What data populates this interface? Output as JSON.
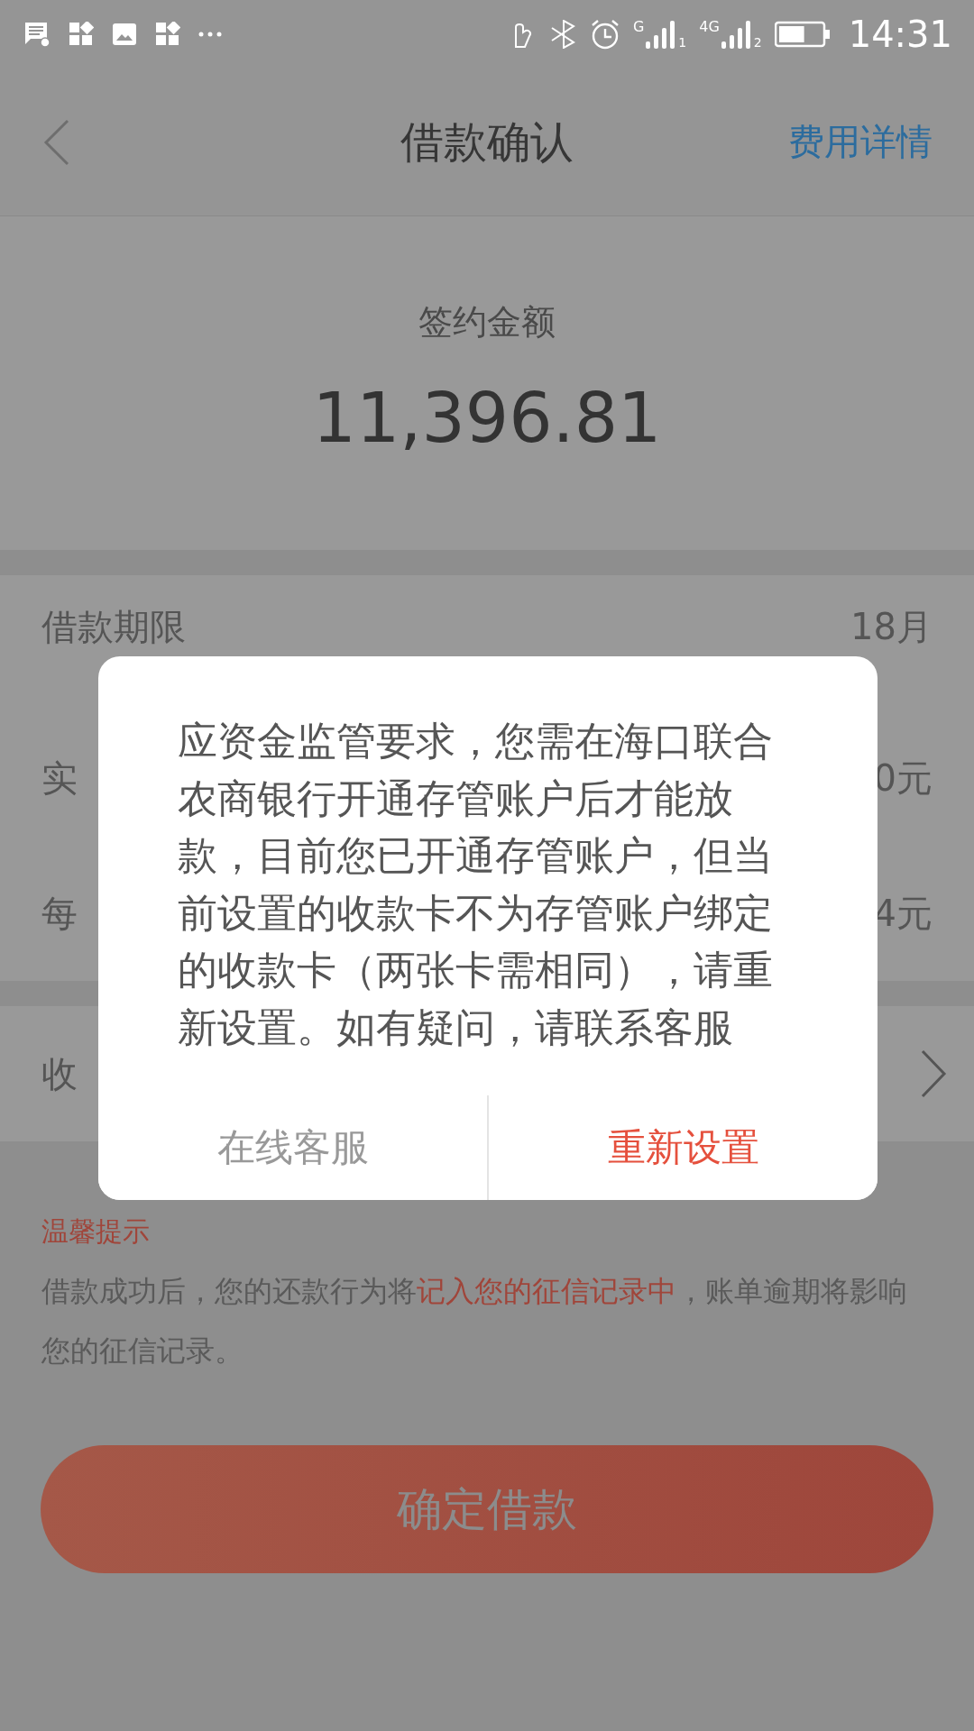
{
  "status_bar": {
    "signals": [
      {
        "network": "G",
        "sim": "1"
      },
      {
        "network": "4G",
        "sim": "2"
      }
    ],
    "battery": {
      "level": 0.6
    },
    "time": "14:31"
  },
  "header": {
    "title": "借款确认",
    "action": "费用详情"
  },
  "amount": {
    "label": "签约金额",
    "value": "11,396.81"
  },
  "rows": [
    {
      "label": "借款期限",
      "value": "18月"
    },
    {
      "label": "实",
      "value": "0元"
    },
    {
      "label": "每",
      "value": "4元"
    }
  ],
  "card_row": {
    "label": "收",
    "chevron": true
  },
  "tip": {
    "title": "温馨提示",
    "segments": [
      {
        "text": "借款成功后，您的还款行为将",
        "emphasis": false
      },
      {
        "text": "记入您的征信记录中",
        "emphasis": true
      },
      {
        "text": "，账单逾期将影响您的征信记录。",
        "emphasis": false
      }
    ]
  },
  "confirm_button": "确定借款",
  "dialog": {
    "message": "应资金监管要求，您需在海口联合农商银行开通存管账户后才能放款，目前您已开通存管账户，但当前设置的收款卡不为存管账户绑定的收款卡（两张卡需相同），请重新设置。如有疑问，请联系客服",
    "buttons": [
      {
        "label": "在线客服",
        "kind": "secondary"
      },
      {
        "label": "重新设置",
        "kind": "primary"
      }
    ]
  }
}
